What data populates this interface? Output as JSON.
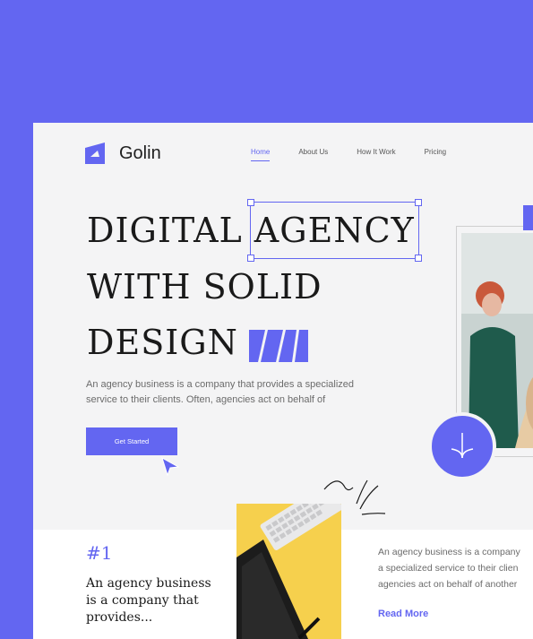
{
  "brand": {
    "name": "Golin"
  },
  "nav": {
    "items": [
      "Home",
      "About Us",
      "How It Work",
      "Pricing"
    ]
  },
  "hero": {
    "line1_a": "DIGITAL",
    "line1_b": "AGENCY",
    "line2": "WITH SOLID",
    "line3": "DESIGN"
  },
  "description": "An agency business is a company that provides a specialized service to their clients. Often, agencies act on behalf of",
  "cta": {
    "label": "Get Started"
  },
  "feature": {
    "number": "#1",
    "text": "An agency business is a company that provides..."
  },
  "right_column": {
    "text_lines": [
      "An agency business is a company",
      "a specialized service to their clien",
      "agencies act on behalf of another"
    ],
    "read_more": "Read More"
  },
  "colors": {
    "accent": "#6366F1",
    "yellow": "#F6D04D",
    "background": "#F4F4F5"
  }
}
